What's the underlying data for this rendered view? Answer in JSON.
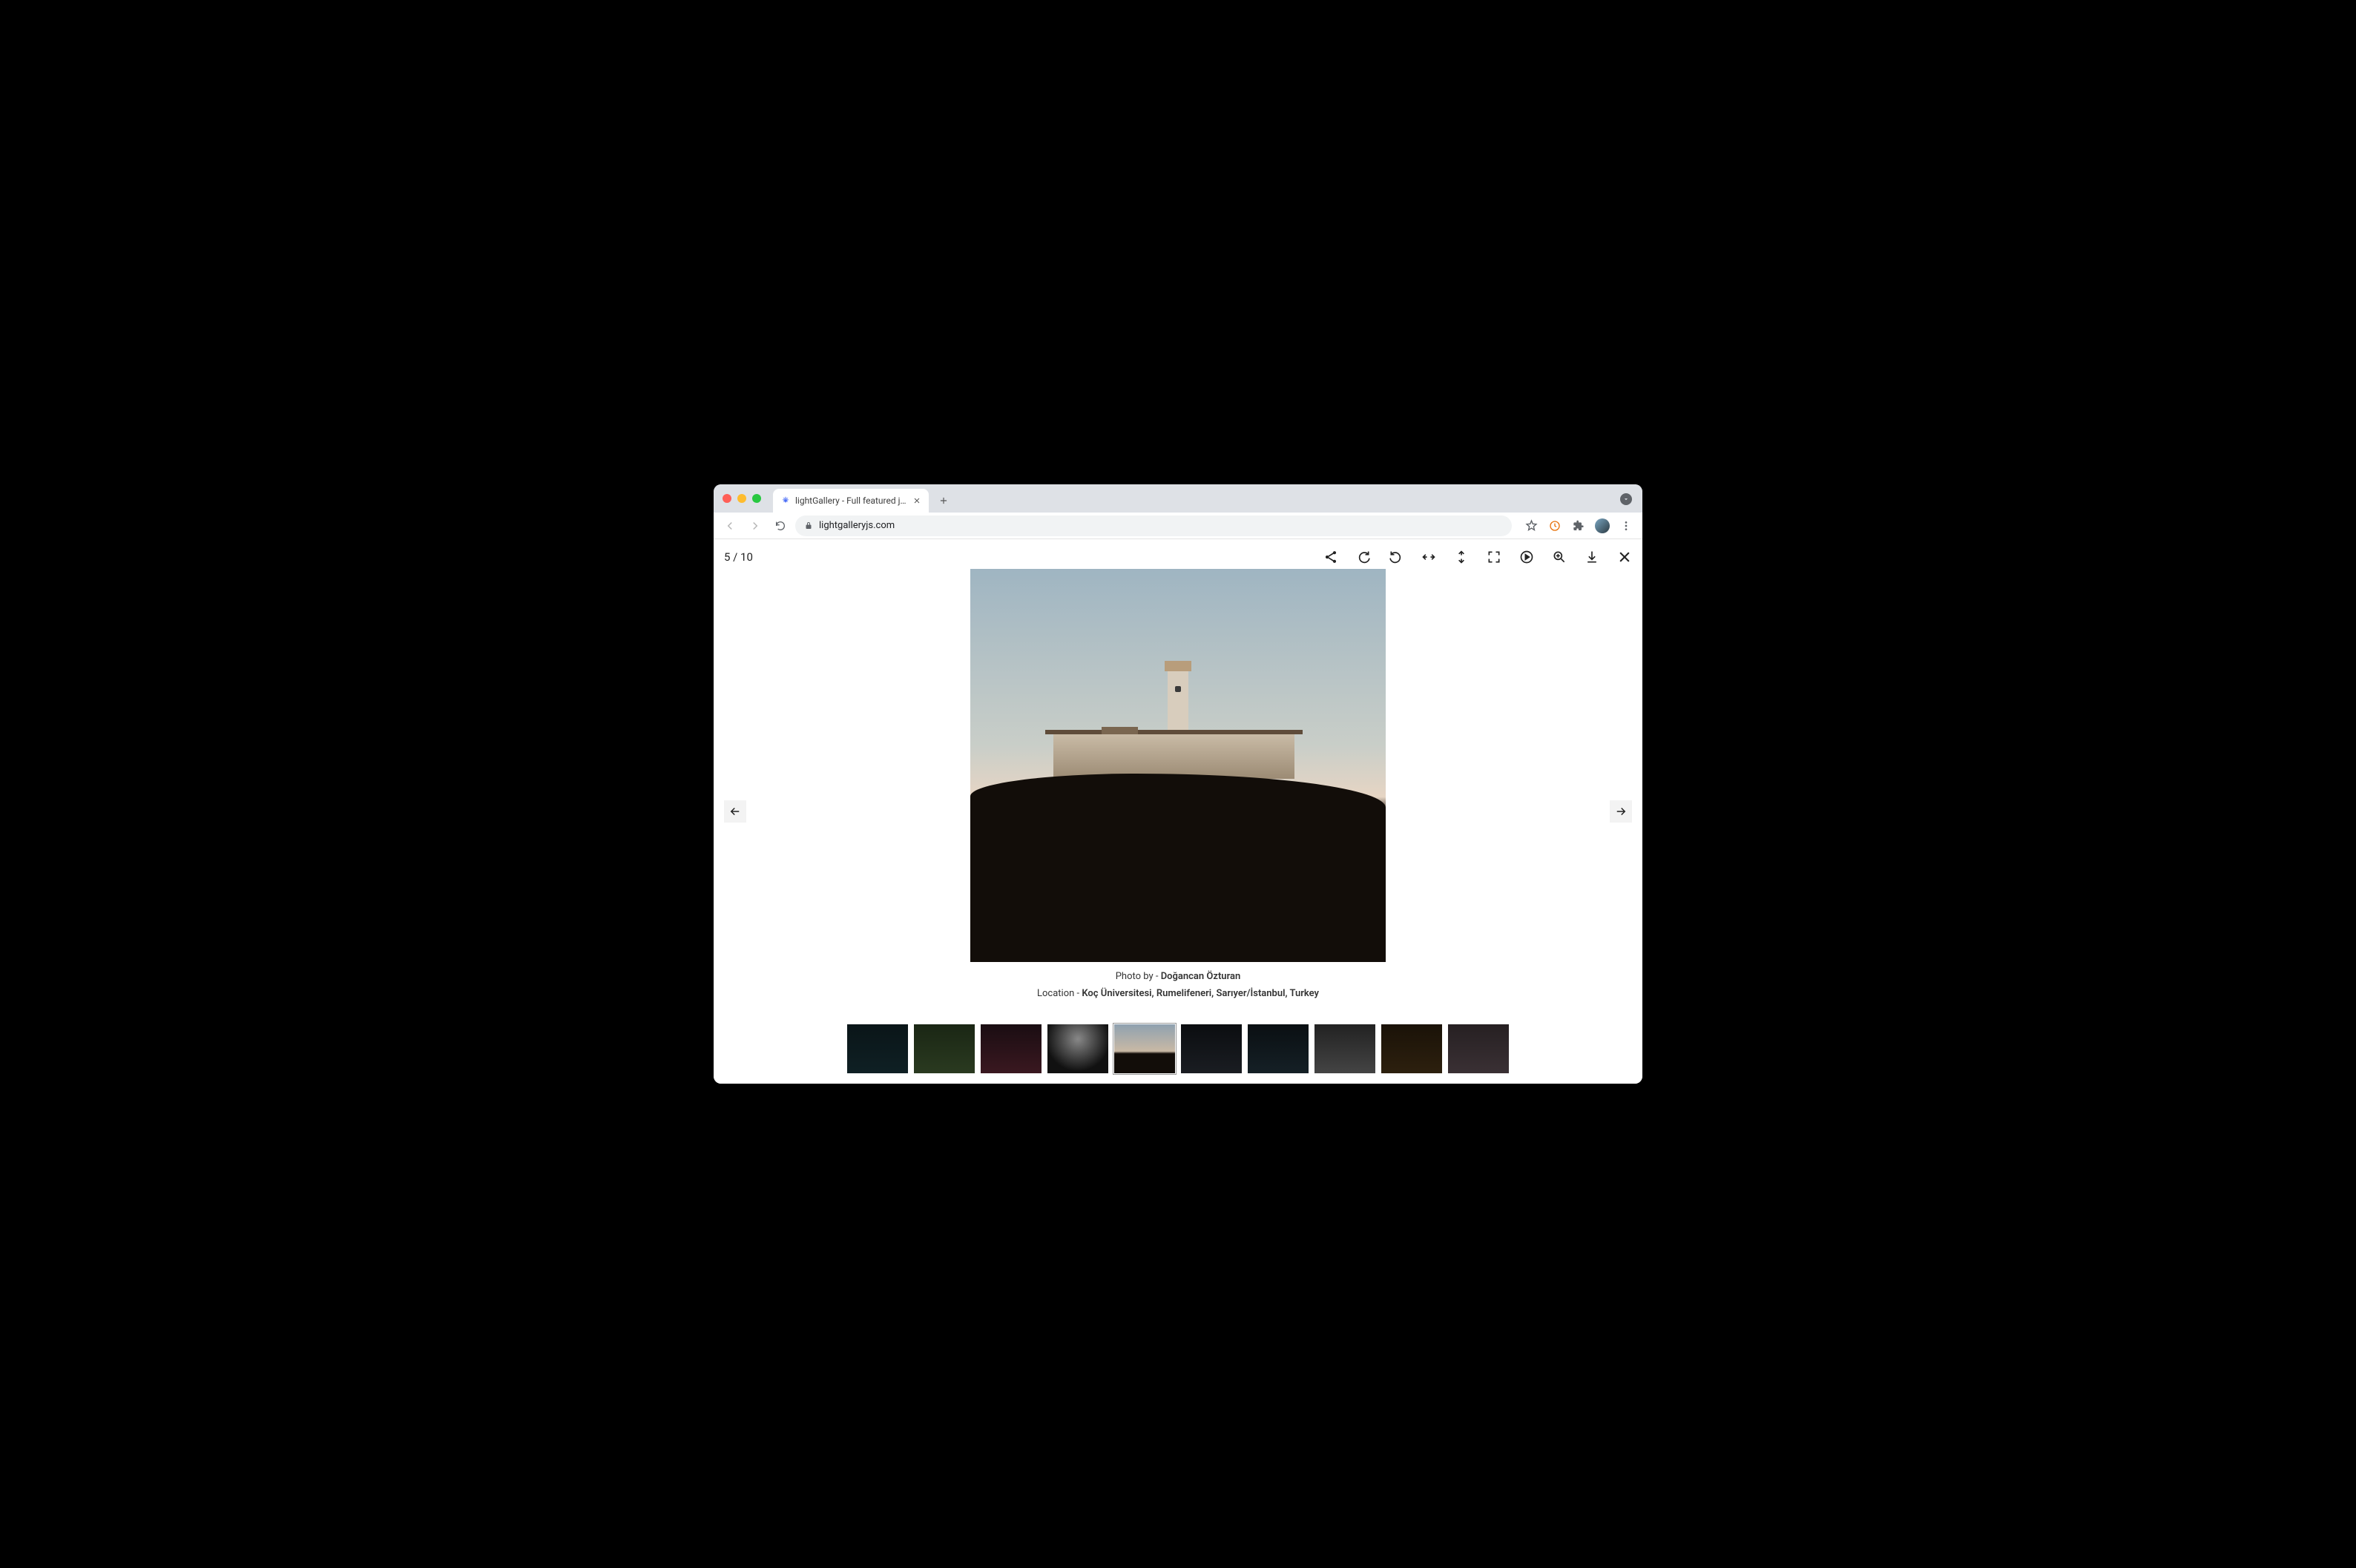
{
  "browser": {
    "tab_title": "lightGallery - Full featured java",
    "url": "lightgalleryjs.com"
  },
  "gallery": {
    "counter": "5 / 10",
    "current_index": 5,
    "total": 10,
    "caption_prefix": "Photo by - ",
    "caption_author": "Doğancan Özturan",
    "location_prefix": "Location - ",
    "location_value": "Koç Üniversitesi, Rumelifeneri, Sarıyer/İstanbul, Turkey",
    "toolbar_icons": [
      "share-icon",
      "rotate-right-icon",
      "rotate-left-icon",
      "flip-horizontal-icon",
      "flip-vertical-icon",
      "fullscreen-icon",
      "autoplay-icon",
      "zoom-icon",
      "download-icon",
      "close-icon"
    ],
    "thumbnails": [
      {
        "active": false
      },
      {
        "active": false
      },
      {
        "active": false
      },
      {
        "active": false
      },
      {
        "active": true
      },
      {
        "active": false
      },
      {
        "active": false
      },
      {
        "active": false
      },
      {
        "active": false
      },
      {
        "active": false
      }
    ]
  }
}
